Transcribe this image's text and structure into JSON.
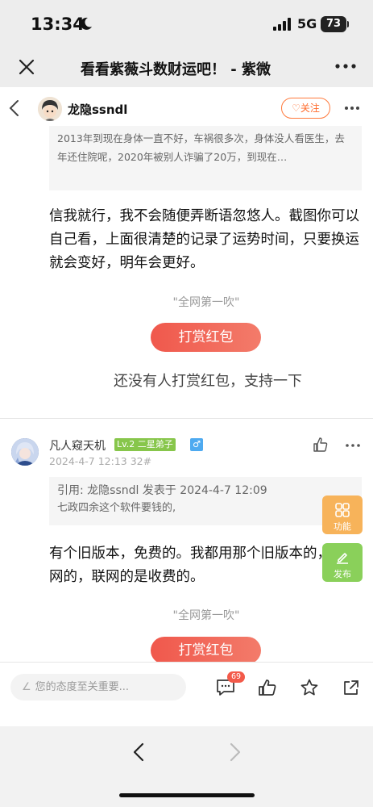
{
  "status": {
    "time": "13:34",
    "network": "5G",
    "battery": "73"
  },
  "browser": {
    "title": "看看紫薇斗数财运吧！ - 紫微"
  },
  "post": {
    "author": "龙隐ssndl",
    "follow_label": "关注",
    "quote_text": "2013年到现在身体一直不好，车祸很多次，身体没人看医生，去年还住院呢，2020年被别人诈骗了20万，到现在…",
    "body": "信我就行，我不会随便弄断语忽悠人。截图你可以自己看，上面很清楚的记录了运势时间，只要换运就会变好，明年会更好。",
    "slogan": "\"全网第一吹\"",
    "reward_label": "打赏红包",
    "no_reward_text": "还没有人打赏红包，支持一下"
  },
  "reply": {
    "author": "凡人窥天机",
    "level": "Lv.2 二星弟子",
    "gender": "♂",
    "date": "2024-4-7 12:13",
    "floor": "32#",
    "quote_ref": "引用: 龙隐ssndl 发表于 2024-4-7 12:09",
    "quote_text": "七政四余这个软件要钱的,",
    "body": "有个旧版本，免费的。我都用那个旧版本的，不联网的，联网的是收费的。",
    "slogan": "\"全网第一吹\"",
    "reward_label": "打赏红包"
  },
  "floating": {
    "function_label": "功能",
    "post_label": "发布"
  },
  "bottom": {
    "comment_placeholder": "您的态度至关重要...",
    "comment_count": "69"
  },
  "colors": {
    "accent": "#f0584c",
    "follow": "#ff6a2a",
    "level_badge": "#87c64b",
    "function_btn": "#f7b35a",
    "post_btn": "#8ad05a"
  }
}
